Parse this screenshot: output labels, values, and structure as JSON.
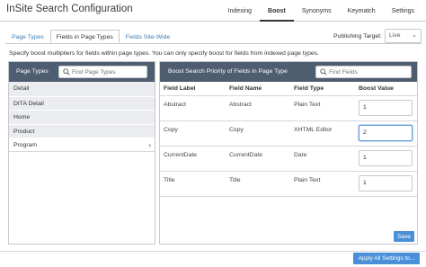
{
  "app": {
    "title": "InSite Search Configuration"
  },
  "top_nav": [
    "Indexing",
    "Boost",
    "Synonyms",
    "Keymatch",
    "Settings"
  ],
  "tabs": [
    "Page Types",
    "Fields in Page Types",
    "Fields Site-Wide"
  ],
  "publishing_target": {
    "label": "Publishing Target:",
    "value": "Live"
  },
  "description": "Specify boost multipliers for fields within page types. You can only specify boost for fields from indexed page types.",
  "page_types_panel": {
    "header": "Page Types",
    "search_placeholder": "Find Page Types",
    "items": [
      "Detail",
      "DITA Detail",
      "Home",
      "Product",
      "Program"
    ]
  },
  "fields_panel": {
    "header": "Boost Search Priority of Fields in Page Type",
    "search_placeholder": "Find Fields",
    "columns": [
      "Field Label",
      "Field Name",
      "Field Type",
      "Boost Value"
    ],
    "rows": [
      {
        "label": "Abstract",
        "name": "Abstract",
        "type": "Plain Text",
        "boost": "1"
      },
      {
        "label": "Copy",
        "name": "Copy",
        "type": "XHTML Editor",
        "boost": "2"
      },
      {
        "label": "CurrentDate",
        "name": "CurrentDate",
        "type": "Date",
        "boost": "1"
      },
      {
        "label": "Title",
        "name": "Title",
        "type": "Plain Text",
        "boost": "1"
      }
    ],
    "save_label": "Save"
  },
  "apply_label": "Apply All Settings to...",
  "colors": {
    "panel_header": "#4e5d6f",
    "primary_button": "#4a90d9",
    "link": "#3b7bb7"
  }
}
